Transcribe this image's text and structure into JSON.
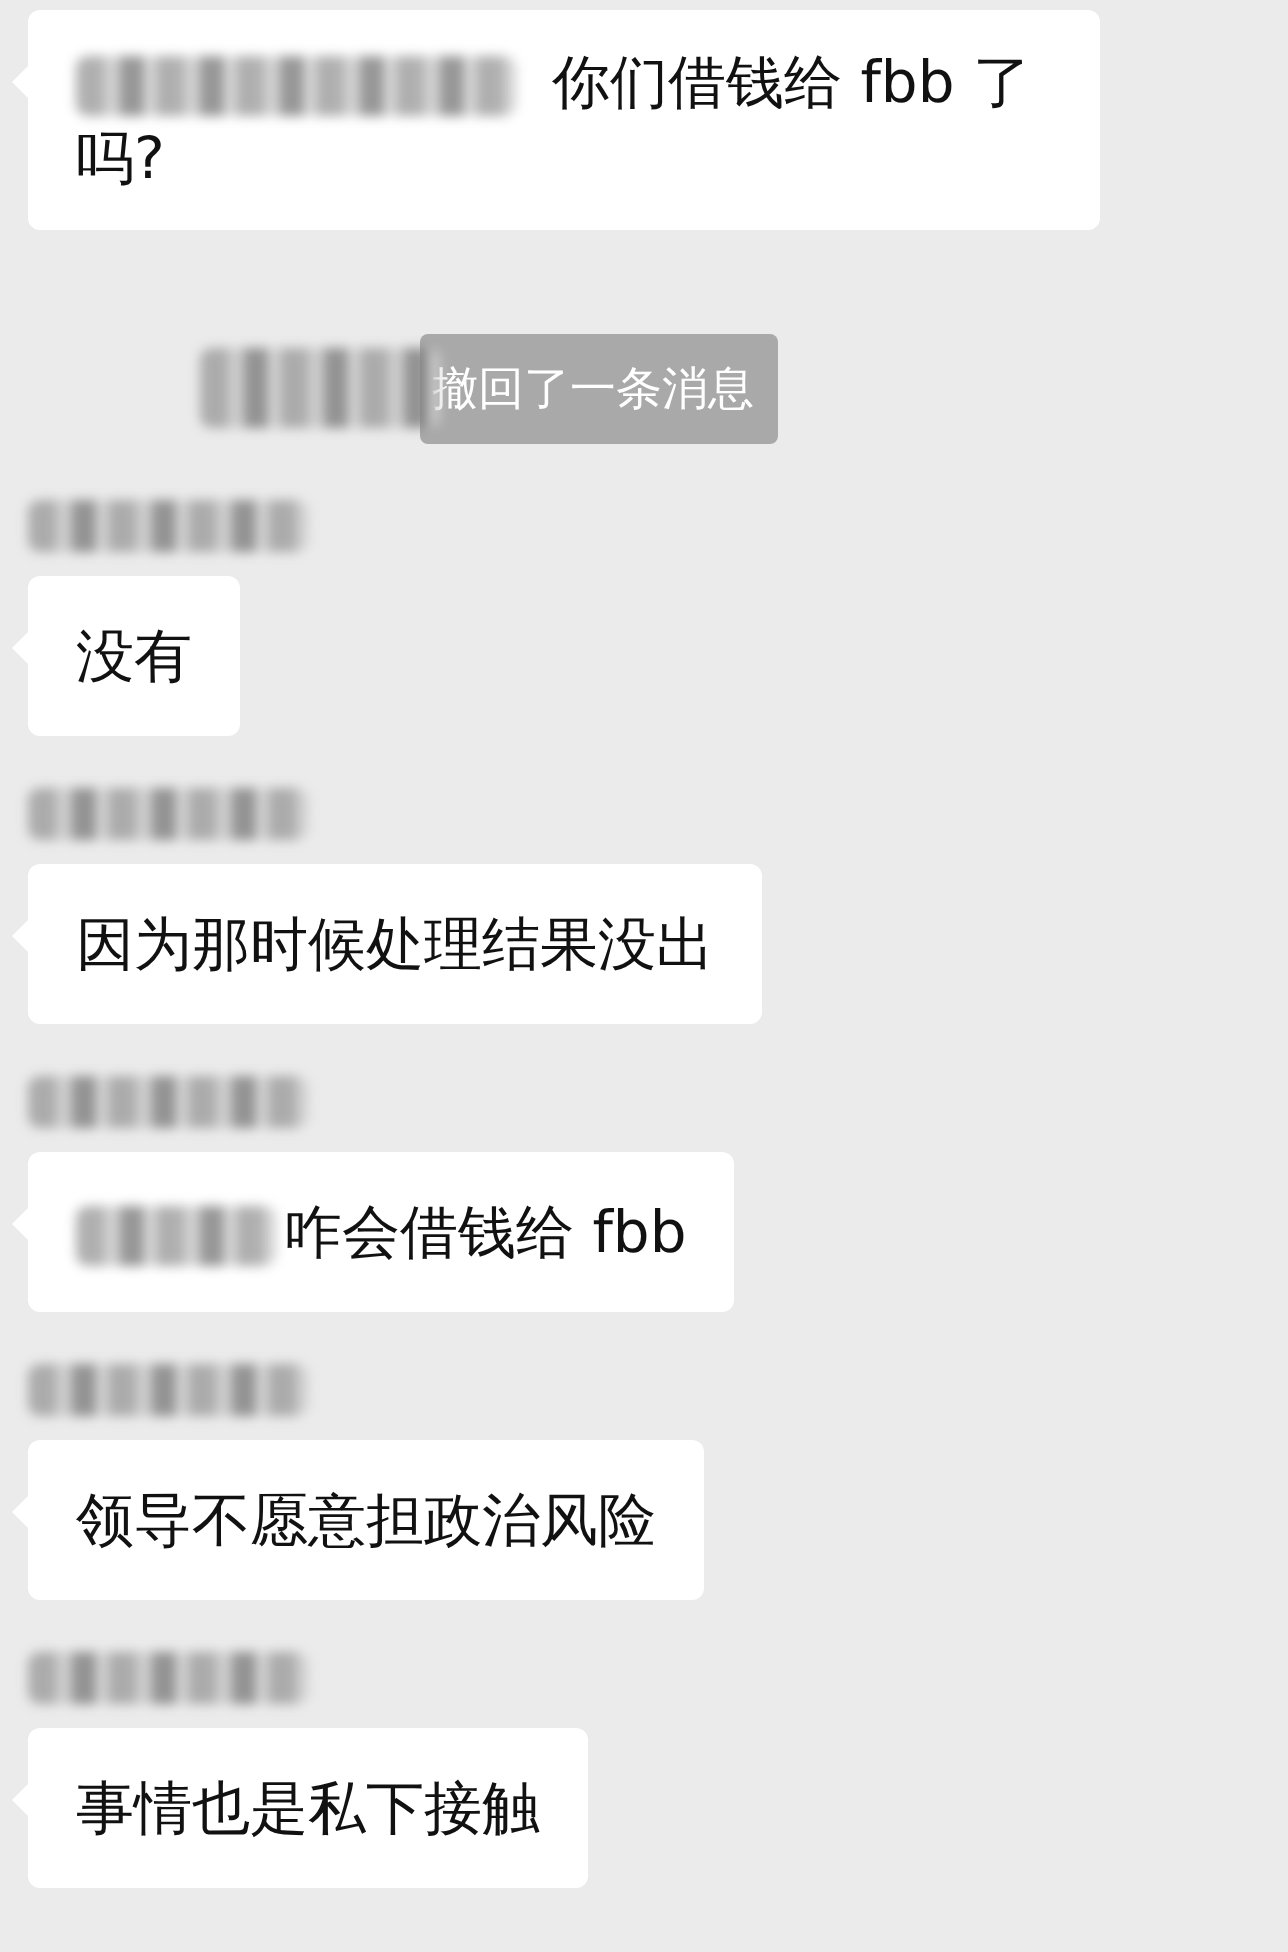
{
  "messages": [
    {
      "kind": "text",
      "prefix_hidden": true,
      "text": "你们借钱给 fbb 了吗?"
    },
    {
      "kind": "recall",
      "text": "撤回了一条消息"
    },
    {
      "kind": "text",
      "prefix_hidden": false,
      "text": "没有"
    },
    {
      "kind": "text",
      "prefix_hidden": false,
      "text": "因为那时候处理结果没出"
    },
    {
      "kind": "text",
      "prefix_hidden": true,
      "text": "咋会借钱给 fbb"
    },
    {
      "kind": "text",
      "prefix_hidden": false,
      "text": "领导不愿意担政治风险"
    },
    {
      "kind": "text",
      "prefix_hidden": false,
      "text": "事情也是私下接触"
    }
  ]
}
